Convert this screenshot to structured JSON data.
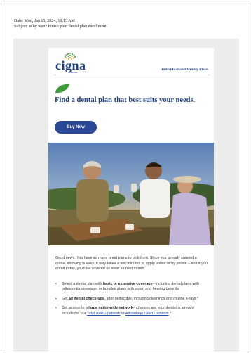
{
  "email": {
    "date_line": "Date: Mon, Jan 15, 2024, 10:13 AM",
    "subject_line": "Subject: Why wait? Finish your dental plan enrollment."
  },
  "header": {
    "logo_text": "cigna",
    "logo_subtext": "healthcare",
    "plans_link": "Individual and Family Plans"
  },
  "hero": {
    "headline": "Find a dental plan that best suits your needs.",
    "button_label": "Buy Now"
  },
  "body": {
    "intro": "Good news. You have so many great plans to pick from. Since you already created a quote, enrolling is easy. It only takes a few minutes to apply online or by phone – and if you enroll today, you'll be covered as soon as next month."
  },
  "bullets": [
    {
      "pre": "Select a dental plan with ",
      "bold": "basic or extensive coverage",
      "post": "– including dental plans with orthodontia coverage, or bundled plans with vision and hearing benefits."
    },
    {
      "pre": "Get ",
      "bold": "$0 dental check-ups",
      "post": ", after deductible, including cleanings and routine x-rays.*"
    },
    {
      "pre": "Get access to a ",
      "bold": "large nationwide network",
      "post": "– chances are your dentist is already included in our ",
      "link1": "Total DPPO network",
      "mid": " or ",
      "link2": "Advantage DPPO network",
      "end": ".*"
    }
  ],
  "colors": {
    "brand_navy": "#1f3e7c",
    "button_blue": "#2a4896",
    "leaf_green": "#3e9a3a",
    "logo_orange": "#f09a1f"
  }
}
